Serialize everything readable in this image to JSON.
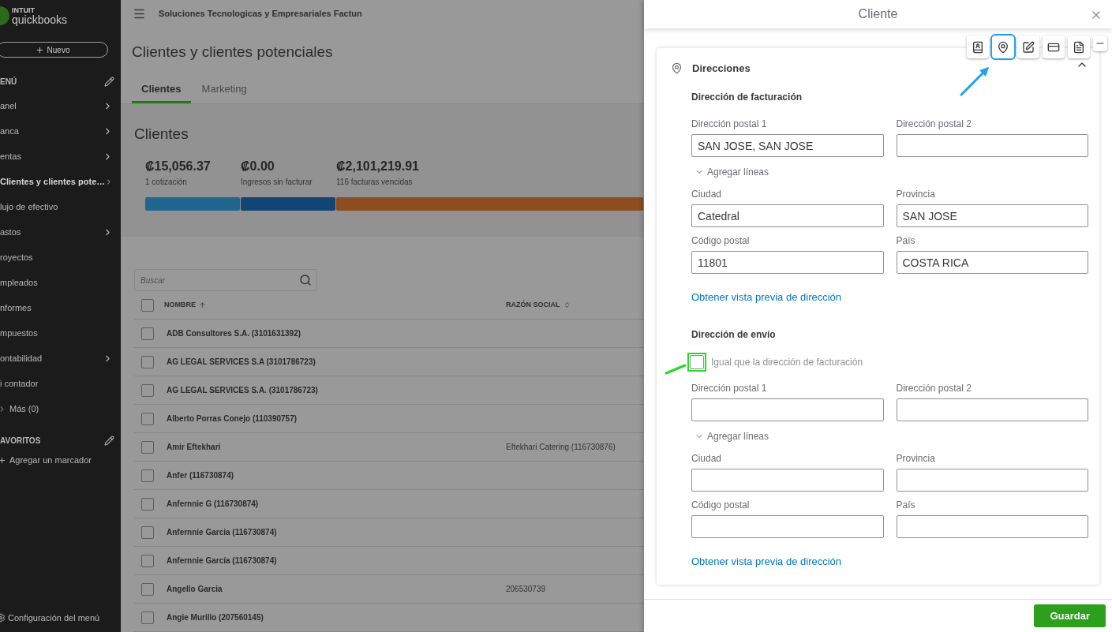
{
  "sidebar": {
    "logo": {
      "top": "INTUIT",
      "name": "quickbooks"
    },
    "new_button": "Nuevo",
    "menu_header": "ENÚ",
    "items": [
      {
        "label": "anel",
        "chevron": true,
        "selected": false
      },
      {
        "label": "anca",
        "chevron": true,
        "selected": false
      },
      {
        "label": "entas",
        "chevron": true,
        "selected": false
      },
      {
        "label": "Clientes y clientes pote…",
        "chevron": true,
        "selected": true
      },
      {
        "label": "lujo de efectivo",
        "chevron": false,
        "selected": false
      },
      {
        "label": "astos",
        "chevron": true,
        "selected": false
      },
      {
        "label": "royectos",
        "chevron": false,
        "selected": false
      },
      {
        "label": "mpleados",
        "chevron": false,
        "selected": false
      },
      {
        "label": "nformes",
        "chevron": false,
        "selected": false
      },
      {
        "label": "mpuestos",
        "chevron": false,
        "selected": false
      },
      {
        "label": "ontabilidad",
        "chevron": true,
        "selected": false
      },
      {
        "label": "i contador",
        "chevron": false,
        "selected": false
      }
    ],
    "more": "Más (0)",
    "favorites_header": "AVORITOS",
    "add_bookmark": "Agregar un marcador",
    "settings": "Configuración del menú"
  },
  "topbar": {
    "company": "Soluciones Tecnologicas y Empresariales Factun"
  },
  "page_title": "Clientes y clientes potenciales",
  "tabs": [
    {
      "label": "Clientes",
      "selected": true
    },
    {
      "label": "Marketing",
      "selected": false
    }
  ],
  "summary": {
    "title": "Clientes",
    "items": [
      {
        "amount": "₡15,056.37",
        "label": "1 cotización",
        "color": "#21668f"
      },
      {
        "amount": "₡0.00",
        "label": "Ingresos sin facturar",
        "color": "#104574"
      },
      {
        "amount": "₡2,101,219.91",
        "label": "116 facturas vencidas",
        "color": "#8c4d20"
      }
    ]
  },
  "table": {
    "search_placeholder": "Buscar",
    "all_checked": false,
    "columns": [
      {
        "label": "NOMBRE",
        "sorted": true
      },
      {
        "label": "RAZÓN SOCIAL",
        "sorted": false
      }
    ],
    "rows": [
      {
        "name": "ADB Consultores S.A. (3101631392)",
        "checked": false
      },
      {
        "name": "AG LEGAL SERVICES S.A (3101786723)",
        "checked": false
      },
      {
        "name": "AG LEGAL SERVICES S.A. (3101786723)",
        "checked": false
      },
      {
        "name": "Alberto Porras Conejo (110390757)",
        "checked": false
      },
      {
        "name": "Amir Eftekhari",
        "company": "Eftekhari Catering (116730876)",
        "checked": false
      },
      {
        "name": "Anfer (116730874)",
        "checked": false
      },
      {
        "name": "Anfernnie G (116730874)",
        "checked": false
      },
      {
        "name": "Anfernnie Garcia (116730874)",
        "checked": false
      },
      {
        "name": "Anfernnie García (116730874)",
        "checked": false
      },
      {
        "name": "Angello Garcia",
        "company": "206530739",
        "checked": false
      },
      {
        "name": "Angie Murillo (207560145)",
        "checked": false
      }
    ]
  },
  "panel": {
    "title": "Cliente",
    "toolbar": [
      {
        "kind": "contacts",
        "selected": false
      },
      {
        "kind": "location",
        "selected": true
      },
      {
        "kind": "edit",
        "selected": false
      },
      {
        "kind": "payment",
        "selected": false
      },
      {
        "kind": "document",
        "selected": false
      },
      {
        "kind": "minimize",
        "selected": false
      }
    ],
    "section": {
      "title": "Direcciones",
      "expanded": true,
      "billing": {
        "heading": "Dirección de facturación",
        "address": [
          {
            "label": "Dirección postal 1",
            "value": "SAN JOSE, SAN JOSE"
          },
          {
            "label": "Dirección postal 2"
          }
        ],
        "add_lines": "Agregar líneas",
        "fields": [
          {
            "label": "Ciudad",
            "value": "Catedral"
          },
          {
            "label": "Provincia",
            "value": "SAN JOSE"
          },
          {
            "label": "Código postal",
            "value": "11801"
          },
          {
            "label": "País",
            "value": "COSTA RICA"
          }
        ],
        "preview_link": "Obtener vista previa de dirección"
      },
      "shipping": {
        "heading": "Dirección de envío",
        "same_as_billing": {
          "label": "Igual que la dirección de facturación",
          "checked": false,
          "highlighted": true
        },
        "address": [
          {
            "label": "Dirección postal 1"
          },
          {
            "label": "Dirección postal 2"
          }
        ],
        "add_lines": "Agregar líneas",
        "fields": [
          {
            "label": "Ciudad"
          },
          {
            "label": "Provincia"
          },
          {
            "label": "Código postal"
          },
          {
            "label": "País"
          }
        ],
        "preview_link": "Obtener vista previa de dirección"
      }
    },
    "save_button": "Guardar"
  }
}
